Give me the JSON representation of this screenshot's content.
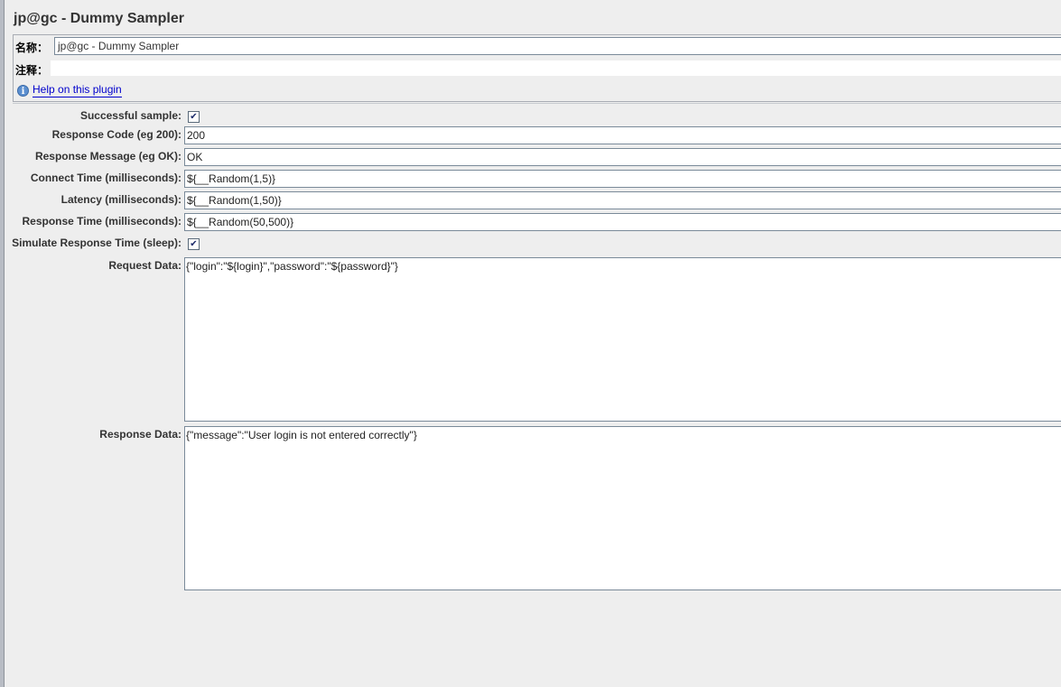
{
  "title": "jp@gc - Dummy Sampler",
  "name_panel": {
    "name_label": "名称：",
    "name_value": "jp@gc - Dummy Sampler",
    "comment_label": "注释：",
    "comment_value": "",
    "help_link": "Help on this plugin",
    "info_icon_glyph": "i"
  },
  "fields": {
    "successful_sample": {
      "label": "Successful sample:",
      "checked": true,
      "mark": "✔"
    },
    "response_code": {
      "label": "Response Code (eg 200):",
      "value": "200"
    },
    "response_message": {
      "label": "Response Message (eg OK):",
      "value": "OK"
    },
    "connect_time": {
      "label": "Connect Time (milliseconds):",
      "value": "${__Random(1,5)}"
    },
    "latency": {
      "label": "Latency (milliseconds):",
      "value": "${__Random(1,50)}"
    },
    "response_time": {
      "label": "Response Time (milliseconds):",
      "value": "${__Random(50,500)}"
    },
    "simulate_sleep": {
      "label": "Simulate Response Time (sleep):",
      "checked": true,
      "mark": "✔"
    },
    "request_data": {
      "label": "Request Data:",
      "value": "{\"login\":\"${login}\",\"password\":\"${password}\"}"
    },
    "response_data": {
      "label": "Response Data:",
      "value": "{\"message\":\"User login is not entered correctly\"}"
    }
  }
}
